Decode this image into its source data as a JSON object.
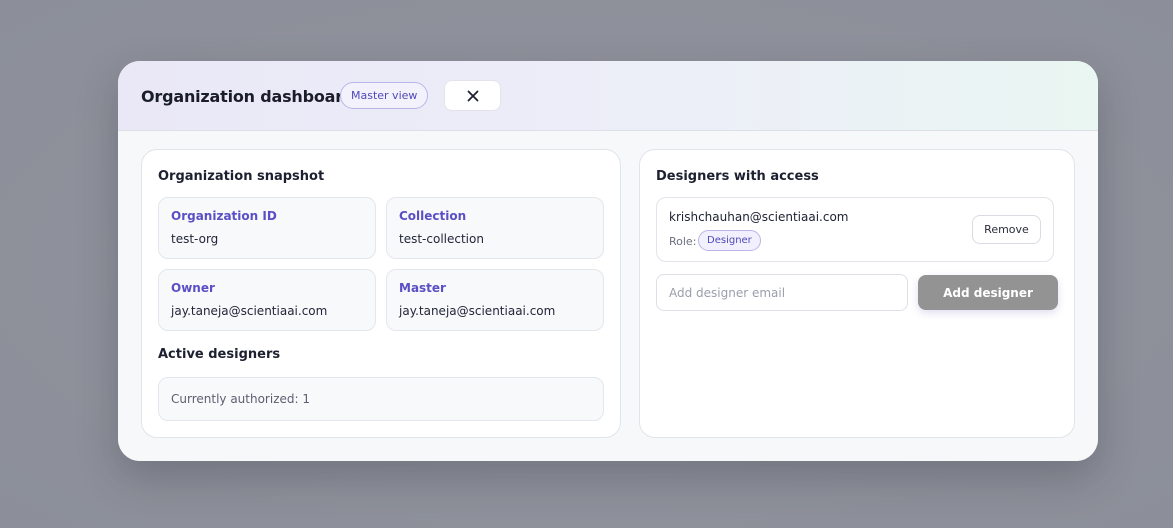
{
  "header": {
    "title": "Organization dashboard",
    "badge": "Master view",
    "close_icon": "close-icon"
  },
  "snapshot": {
    "title": "Organization snapshot",
    "cards": [
      {
        "label": "Organization ID",
        "value": "test-org"
      },
      {
        "label": "Collection",
        "value": "test-collection"
      },
      {
        "label": "Owner",
        "value": "jay.taneja@scientiaai.com"
      },
      {
        "label": "Master",
        "value": "jay.taneja@scientiaai.com"
      }
    ],
    "active_title": "Active designers",
    "authorized_text": "Currently authorized: 1"
  },
  "designers": {
    "title": "Designers with access",
    "items": [
      {
        "email": "krishchauhan@scientiaai.com",
        "role_label": "Role:",
        "role": "Designer",
        "remove_label": "Remove"
      }
    ],
    "input_placeholder": "Add designer email",
    "input_value": "",
    "add_label": "Add designer"
  },
  "colors": {
    "accent": "#5a4fc4",
    "backdrop": "#8f929c",
    "add_button": "#939393"
  }
}
